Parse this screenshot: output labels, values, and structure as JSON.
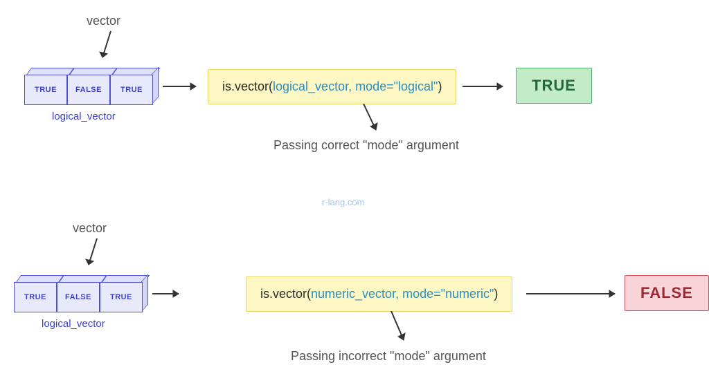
{
  "top": {
    "vector_label": "vector",
    "cells": [
      "TRUE",
      "FALSE",
      "TRUE"
    ],
    "vector_name": "logical_vector",
    "code_func": "is.vector(",
    "code_arg": "logical_vector, mode=\"logical\"",
    "code_close": ")",
    "annotation": "Passing correct \"mode\" argument",
    "result": "TRUE"
  },
  "bottom": {
    "vector_label": "vector",
    "cells": [
      "TRUE",
      "FALSE",
      "TRUE"
    ],
    "vector_name": "logical_vector",
    "code_func": "is.vector(",
    "code_arg": "numeric_vector, mode=\"numeric\"",
    "code_close": ")",
    "annotation": "Passing incorrect \"mode\" argument",
    "result": "FALSE"
  },
  "watermark": "r-lang.com"
}
